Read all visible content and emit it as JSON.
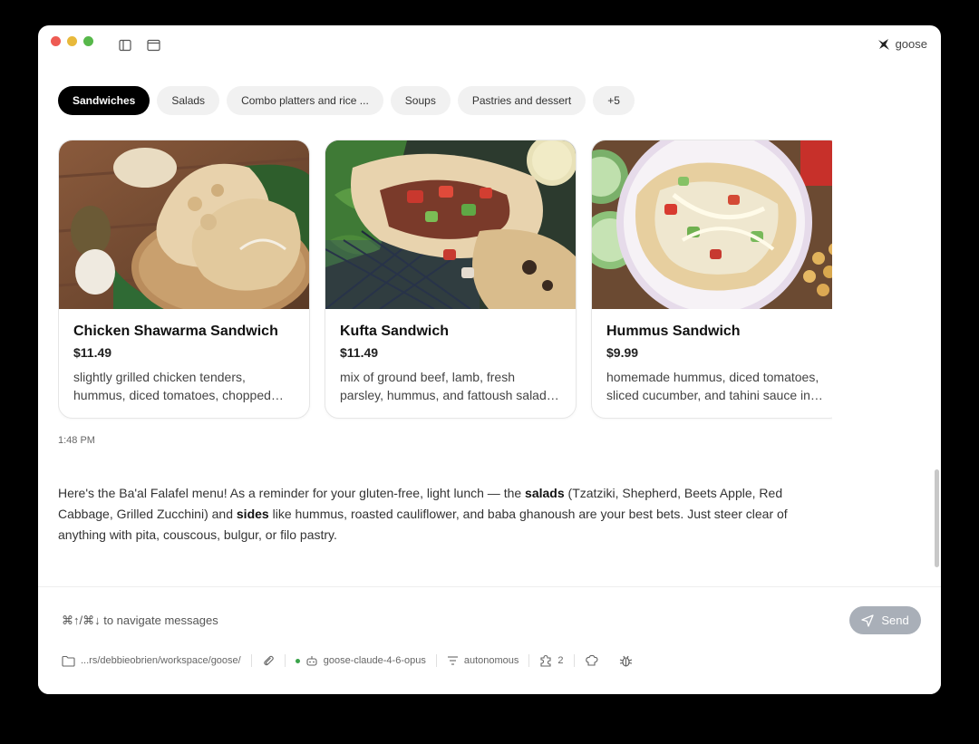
{
  "app": {
    "name": "goose"
  },
  "chips": [
    {
      "label": "Sandwiches",
      "active": true
    },
    {
      "label": "Salads",
      "active": false
    },
    {
      "label": "Combo platters and rice ...",
      "active": false
    },
    {
      "label": "Soups",
      "active": false
    },
    {
      "label": "Pastries and dessert",
      "active": false
    },
    {
      "label": "+5",
      "active": false
    }
  ],
  "cards": [
    {
      "name": "Chicken Shawarma Sandwich",
      "price": "$11.49",
      "description": "slightly grilled chicken tenders, hummus, diced tomatoes, chopped parsley, and tahini sauce in pita"
    },
    {
      "name": "Kufta Sandwich",
      "price": "$11.49",
      "description": "mix of ground beef, lamb, fresh parsley, hummus, and fattoush salad in pita"
    },
    {
      "name": "Hummus Sandwich",
      "price": "$9.99",
      "description": "homemade hummus, diced tomatoes, sliced cucumber, and tahini sauce in pita"
    }
  ],
  "timestamp": "1:48 PM",
  "message": {
    "p1": "Here's the Ba'al Falafel menu! As a reminder for your gluten-free, light lunch — the ",
    "b1": "salads",
    "p2": " (Tzatziki, Shepherd, Beets Apple, Red Cabbage, Grilled Zucchini) and ",
    "b2": "sides",
    "p3": " like hummus, roasted cauliflower, and baba ghanoush are your best bets. Just steer clear of anything with pita, couscous, bulgur, or filo pastry."
  },
  "composer": {
    "hint": "⌘↑/⌘↓ to navigate messages",
    "send_label": "Send"
  },
  "status": {
    "path": "...rs/debbieobrien/workspace/goose/",
    "model": "goose-claude-4-6-opus",
    "mode": "autonomous",
    "extensions_count": "2"
  },
  "colors": {
    "active_chip": "#000000",
    "send_button": "#a9afb8",
    "model_dot": "#3aa34a"
  }
}
